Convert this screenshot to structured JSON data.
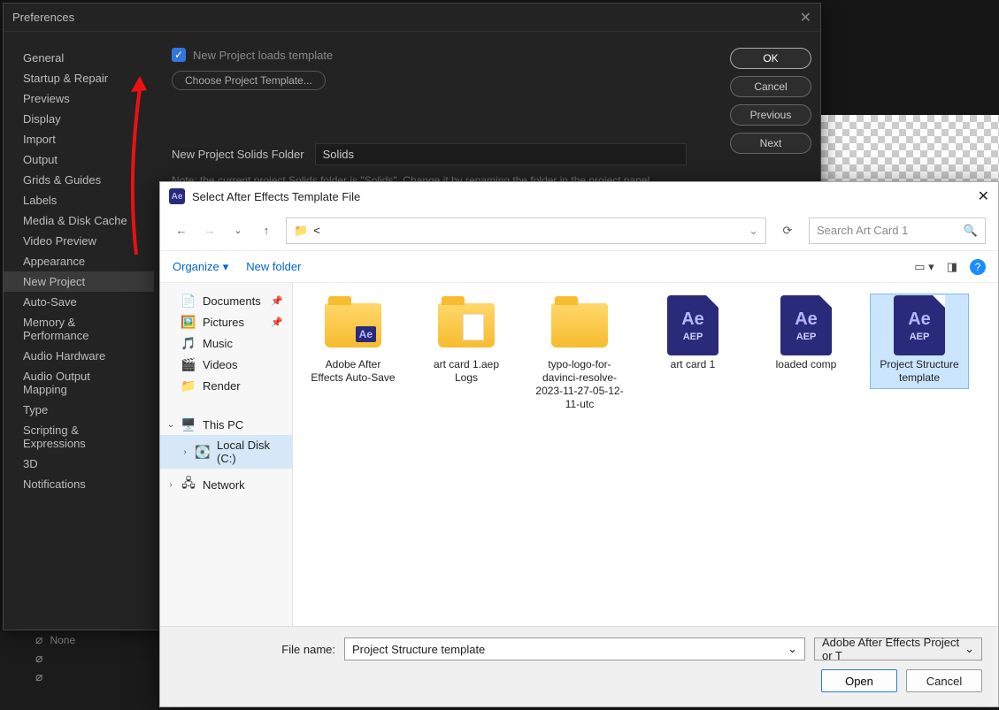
{
  "prefs": {
    "title": "Preferences",
    "sidebar": [
      "General",
      "Startup & Repair",
      "Previews",
      "Display",
      "Import",
      "Output",
      "Grids & Guides",
      "Labels",
      "Media & Disk Cache",
      "Video Preview",
      "Appearance",
      "New Project",
      "Auto-Save",
      "Memory & Performance",
      "Audio Hardware",
      "Audio Output Mapping",
      "Type",
      "Scripting & Expressions",
      "3D",
      "Notifications"
    ],
    "activeIndex": 11,
    "checkbox_label": "New Project loads template",
    "choose_label": "Choose Project Template...",
    "solids_label": "New Project Solids Folder",
    "solids_value": "Solids",
    "note": "Note: the current project Solids folder is \"Solids\". Change it by renaming the folder in the project panel.",
    "buttons": {
      "ok": "OK",
      "cancel": "Cancel",
      "previous": "Previous",
      "next": "Next"
    }
  },
  "bottom": {
    "dropdown": "None"
  },
  "filedlg": {
    "title": "Select After Effects Template File",
    "path_display": "<",
    "search_placeholder": "Search Art Card 1",
    "organize": "Organize",
    "new_folder": "New folder",
    "sidebar": {
      "quick": [
        {
          "label": "Documents",
          "icon": "doc",
          "pinned": true
        },
        {
          "label": "Pictures",
          "icon": "pic",
          "pinned": true
        },
        {
          "label": "Music",
          "icon": "music",
          "pinned": false
        },
        {
          "label": "Videos",
          "icon": "video",
          "pinned": false
        },
        {
          "label": "Render",
          "icon": "folder",
          "pinned": false
        }
      ],
      "this_pc": "This PC",
      "local_disk": "Local Disk (C:)",
      "network": "Network"
    },
    "files": [
      {
        "type": "folder-ae",
        "label": "Adobe After Effects Auto-Save"
      },
      {
        "type": "folder-paper",
        "label": "art card 1.aep Logs"
      },
      {
        "type": "folder",
        "label": "typo-logo-for-davinci-resolve-2023-11-27-05-12-11-utc"
      },
      {
        "type": "aep",
        "label": "art card 1"
      },
      {
        "type": "aep",
        "label": "loaded comp"
      },
      {
        "type": "aep",
        "label": "Project Structure template",
        "selected": true
      }
    ],
    "filename_label": "File name:",
    "filename_value": "Project Structure template",
    "filter_label": "Adobe After Effects Project or T",
    "open": "Open",
    "cancel": "Cancel"
  }
}
